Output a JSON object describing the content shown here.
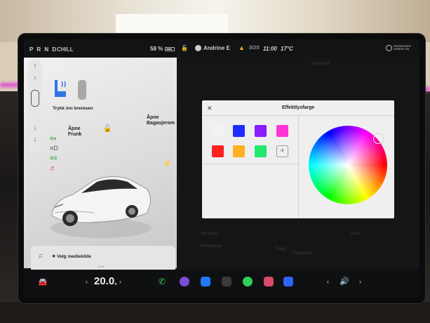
{
  "status_bar": {
    "gear": "P R N D",
    "drive_mode": "CHILL",
    "battery": "58 %",
    "user": "Andrine E",
    "sos": "SOS",
    "time": "11:00",
    "temperature": "17°C",
    "airbag_label": "PASSENGER AIRBAG ON"
  },
  "car_panel": {
    "brake_text": "Trykk inn bremsen",
    "frunk_label": "Åpne\nFrunk",
    "trunk_label": "Åpne\nBagasjerom",
    "media_source": "Velg mediekilde",
    "seat_color": "#2f74e6"
  },
  "modal": {
    "close_glyph": "✕",
    "title": "Effektlysfarge",
    "add_label": "+",
    "swatches": [
      {
        "color": "#f2f2f2",
        "name": "white"
      },
      {
        "color": "#1f2bff",
        "name": "blue"
      },
      {
        "color": "#8a1cff",
        "name": "purple"
      },
      {
        "color": "#ff33d6",
        "name": "magenta"
      },
      {
        "color": "#ff2020",
        "name": "red"
      },
      {
        "color": "#ffb020",
        "name": "orange"
      },
      {
        "color": "#22e870",
        "name": "green"
      }
    ]
  },
  "ghost_texts": {
    "t1": "Andrine E",
    "t2": "Tinkja",
    "t3": "Sensorer",
    "t4": "Auto",
    "t5": "Forsinkelse",
    "t6": "Fotografier"
  },
  "taskbar": {
    "cabin_temp": "20.0",
    "cabin_temp_unit": "°",
    "left_chev": "‹",
    "right_chev": "›"
  }
}
